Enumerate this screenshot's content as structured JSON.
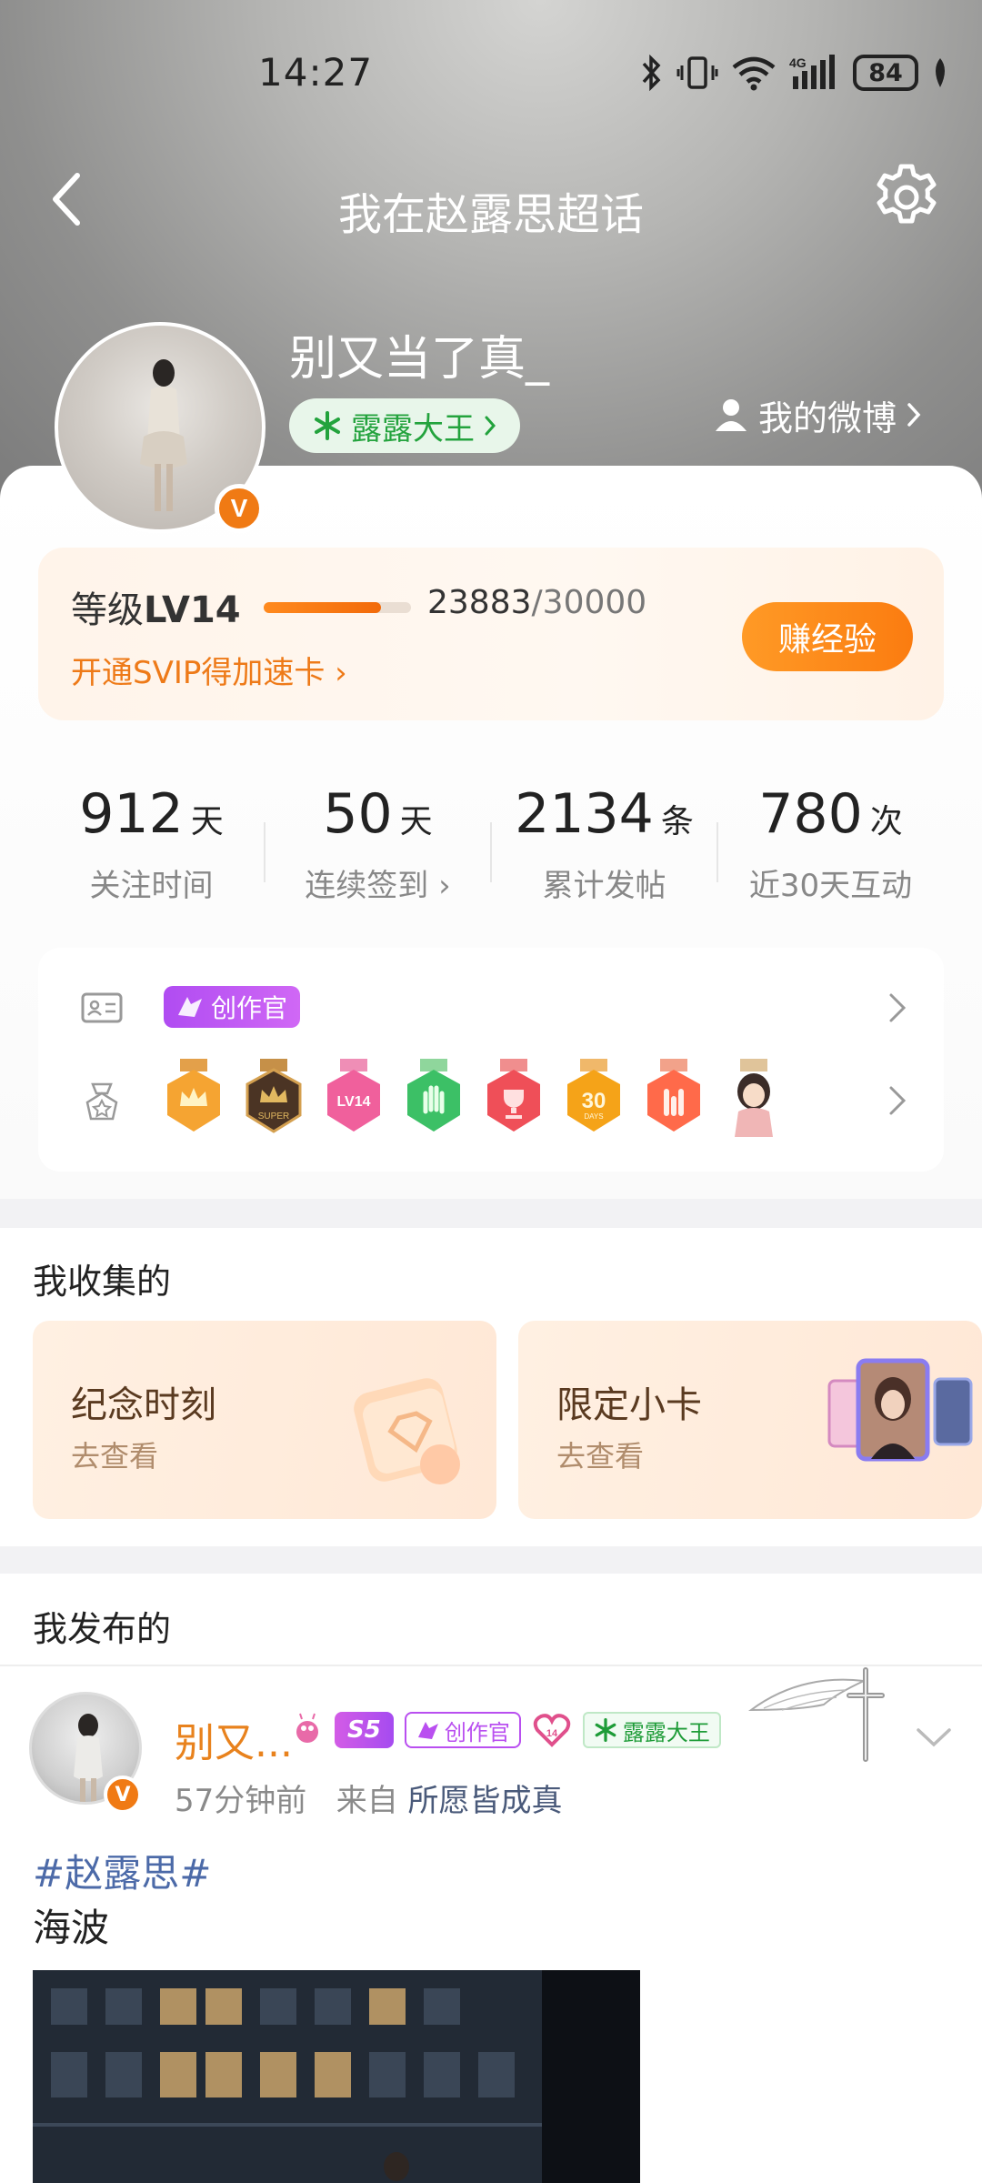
{
  "status_bar": {
    "time": "14:27",
    "battery": "84",
    "network": "4G"
  },
  "nav": {
    "title": "我在赵露思超话"
  },
  "profile": {
    "username": "别又当了真_",
    "fan_title": "露露大王",
    "my_weibo": "我的微博",
    "verified_badge": "V"
  },
  "level": {
    "label_prefix": "等级",
    "level": "LV14",
    "exp_current": "23883",
    "exp_max": "/30000",
    "progress": 0.796,
    "svip_link": "开通SVIP得加速卡 ›",
    "earn_button": "赚经验"
  },
  "stats": [
    {
      "value": "912",
      "unit": "天",
      "label": "关注时间"
    },
    {
      "value": "50",
      "unit": "天",
      "label": "连续签到 ›"
    },
    {
      "value": "2134",
      "unit": "条",
      "label": "累计发帖"
    },
    {
      "value": "780",
      "unit": "次",
      "label": "近30天互动"
    }
  ],
  "badges": {
    "creator_tag": "创作官",
    "medals": [
      "crown-medal",
      "super-medal",
      "lv14-medal",
      "hand-medal",
      "trophy-medal",
      "30-days-medal",
      "rock-medal",
      "character-medal"
    ]
  },
  "collections": {
    "title": "我收集的",
    "items": [
      {
        "title": "纪念时刻",
        "subtitle": "去查看"
      },
      {
        "title": "限定小卡",
        "subtitle": "去查看"
      }
    ]
  },
  "posts": {
    "title": "我发布的",
    "items": [
      {
        "author": "别又...",
        "level_tag": "S5",
        "creator_tag": "创作官",
        "fan_tag": "露露大王",
        "time": "57分钟前",
        "from_prefix": "来自",
        "source": "所愿皆成真",
        "hashtag": "#赵露思#",
        "text": "海波"
      }
    ]
  },
  "colors": {
    "accent_orange": "#F47A12",
    "fan_green": "#23A33D",
    "creator_purple": "#B94FF0",
    "link_blue": "#4C6AA8"
  }
}
